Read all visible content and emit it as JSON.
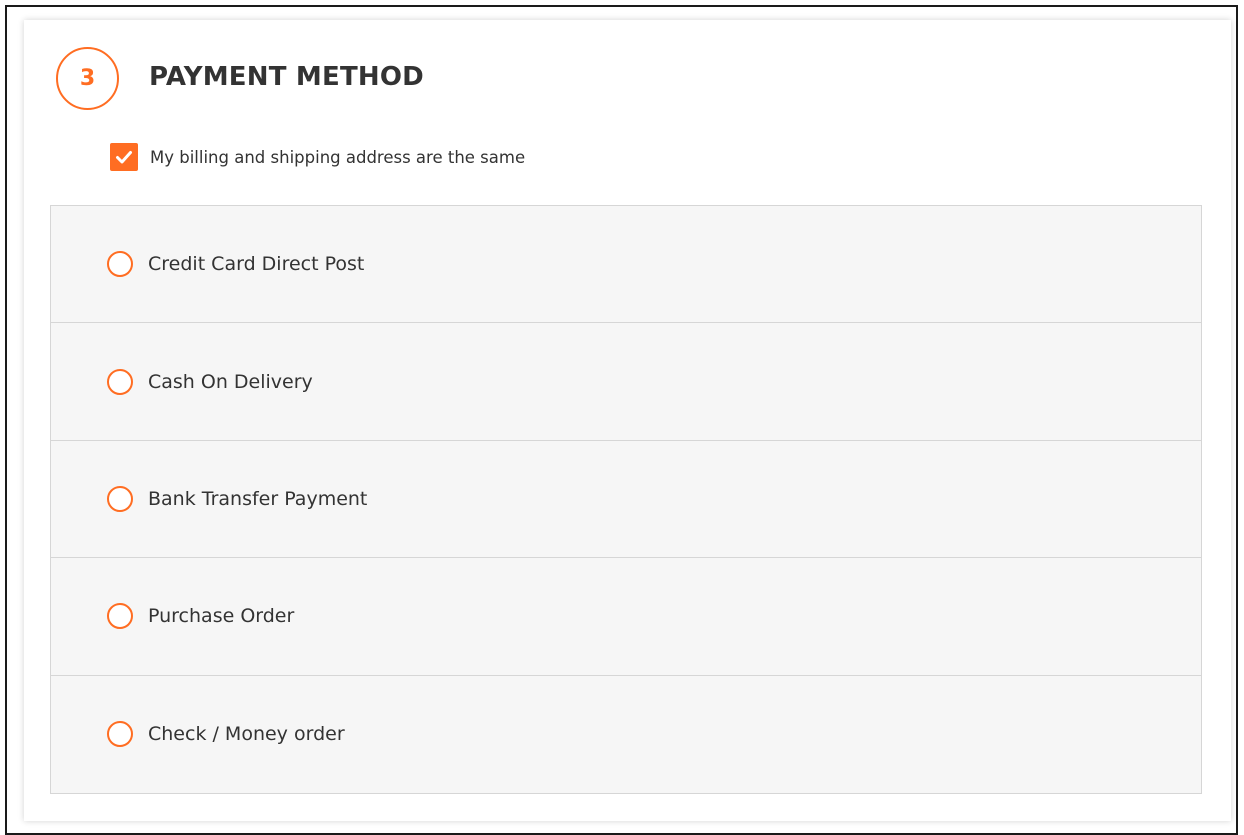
{
  "section": {
    "step_number": "3",
    "title": "PAYMENT METHOD",
    "accent_color": "#ff6d22"
  },
  "billing": {
    "label": "My billing and shipping address are the same",
    "checked": true
  },
  "payment_methods": [
    {
      "label": "Credit Card Direct Post",
      "selected": false
    },
    {
      "label": "Cash On Delivery",
      "selected": false
    },
    {
      "label": "Bank Transfer Payment",
      "selected": false
    },
    {
      "label": "Purchase Order",
      "selected": false
    },
    {
      "label": "Check / Money order",
      "selected": false
    }
  ]
}
